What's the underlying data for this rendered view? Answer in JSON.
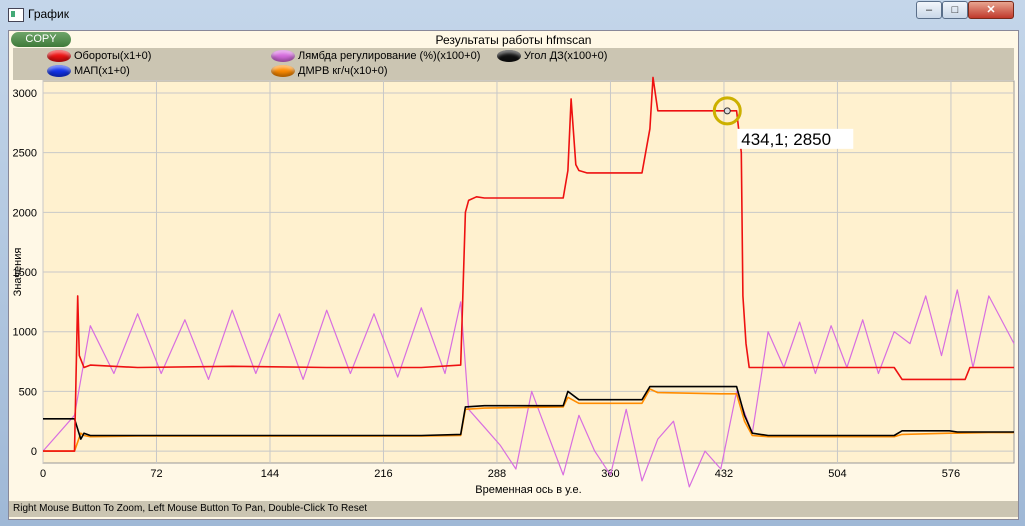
{
  "window": {
    "title": "График"
  },
  "toolbar": {
    "copy_label": "COPY"
  },
  "colors": {
    "rpm": "#ee1111",
    "map": "#1133ee",
    "lambda": "#d86ee0",
    "maf": "#ff8c00",
    "throttle": "#000000"
  },
  "chart_data": {
    "type": "line",
    "title": "Результаты работы hfmscan",
    "xlabel": "Временная ось в у.е.",
    "ylabel": "Значения",
    "xlim": [
      0,
      616
    ],
    "ylim": [
      -100,
      3100
    ],
    "xticks": [
      0,
      72,
      144,
      216,
      288,
      360,
      432,
      504,
      576
    ],
    "yticks": [
      0,
      500,
      1000,
      1500,
      2000,
      2500,
      3000
    ],
    "grid": true,
    "legend_position": "top",
    "legend": [
      {
        "name": "Обороты(x1+0)",
        "color": "#ee1111"
      },
      {
        "name": "Лямбда регулирование (%)(x100+0)",
        "color": "#d86ee0"
      },
      {
        "name": "Угол ДЗ(x100+0)",
        "color": "#000000"
      },
      {
        "name": "МАП(x1+0)",
        "color": "#1133ee"
      },
      {
        "name": "ДМРВ кг/ч(x10+0)",
        "color": "#ff8c00"
      }
    ],
    "annotation": {
      "text": "434,1;  2850",
      "x": 434.1,
      "y": 2850
    },
    "series": [
      {
        "name": "Обороты(x1+0)",
        "color": "#ee1111",
        "x": [
          0,
          20,
          22,
          23,
          26,
          30,
          60,
          120,
          180,
          240,
          265,
          268,
          270,
          275,
          280,
          330,
          333,
          335,
          338,
          340,
          345,
          360,
          380,
          385,
          387,
          390,
          395,
          420,
          440,
          443,
          444,
          446,
          448,
          450,
          460,
          500,
          540,
          545,
          575,
          585,
          588,
          616
        ],
        "y": [
          0,
          0,
          1300,
          800,
          700,
          720,
          700,
          710,
          700,
          700,
          720,
          2000,
          2100,
          2130,
          2120,
          2120,
          2350,
          2950,
          2400,
          2350,
          2330,
          2330,
          2330,
          2700,
          3130,
          2850,
          2850,
          2850,
          2850,
          2500,
          1300,
          900,
          700,
          700,
          700,
          700,
          700,
          600,
          600,
          600,
          700,
          700
        ]
      },
      {
        "name": "Лямбда регулирование (%)(x100+0)",
        "color": "#d86ee0",
        "x": [
          0,
          20,
          30,
          45,
          60,
          75,
          90,
          105,
          120,
          135,
          150,
          165,
          180,
          195,
          210,
          225,
          240,
          255,
          265,
          270,
          280,
          290,
          300,
          310,
          320,
          330,
          340,
          350,
          360,
          370,
          380,
          390,
          400,
          410,
          420,
          430,
          440,
          450,
          460,
          470,
          480,
          490,
          500,
          510,
          520,
          530,
          540,
          550,
          560,
          570,
          580,
          590,
          600,
          616
        ],
        "y": [
          0,
          300,
          1050,
          650,
          1150,
          650,
          1100,
          600,
          1180,
          650,
          1150,
          600,
          1180,
          650,
          1150,
          620,
          1200,
          650,
          1250,
          350,
          200,
          50,
          -150,
          500,
          150,
          -200,
          300,
          0,
          -200,
          350,
          -250,
          100,
          250,
          -300,
          0,
          -150,
          500,
          150,
          1000,
          700,
          1080,
          650,
          1050,
          700,
          1100,
          650,
          1000,
          900,
          1300,
          800,
          1350,
          700,
          1300,
          900
        ]
      },
      {
        "name": "Угол ДЗ(x100+0)",
        "color": "#000000",
        "x": [
          0,
          20,
          24,
          26,
          30,
          60,
          120,
          180,
          240,
          265,
          268,
          280,
          330,
          333,
          340,
          380,
          385,
          390,
          430,
          440,
          445,
          450,
          460,
          500,
          540,
          545,
          575,
          580,
          600,
          616
        ],
        "y": [
          270,
          270,
          100,
          150,
          130,
          130,
          130,
          130,
          130,
          140,
          370,
          380,
          380,
          500,
          430,
          430,
          540,
          540,
          540,
          540,
          300,
          150,
          130,
          130,
          130,
          170,
          170,
          160,
          160,
          160
        ]
      },
      {
        "name": "ДМРВ кг/ч(x10+0)",
        "color": "#ff8c00",
        "x": [
          0,
          20,
          24,
          26,
          30,
          60,
          120,
          180,
          240,
          265,
          268,
          280,
          330,
          333,
          340,
          380,
          385,
          390,
          430,
          440,
          445,
          450,
          460,
          500,
          540,
          545,
          575,
          580,
          600,
          616
        ],
        "y": [
          0,
          0,
          150,
          130,
          120,
          125,
          125,
          125,
          125,
          130,
          350,
          360,
          370,
          450,
          400,
          400,
          520,
          490,
          480,
          480,
          250,
          130,
          120,
          120,
          120,
          140,
          150,
          150,
          155,
          155
        ]
      }
    ]
  },
  "status": {
    "text": "Right Mouse Button To Zoom, Left Mouse Button To Pan, Double-Click To Reset"
  }
}
